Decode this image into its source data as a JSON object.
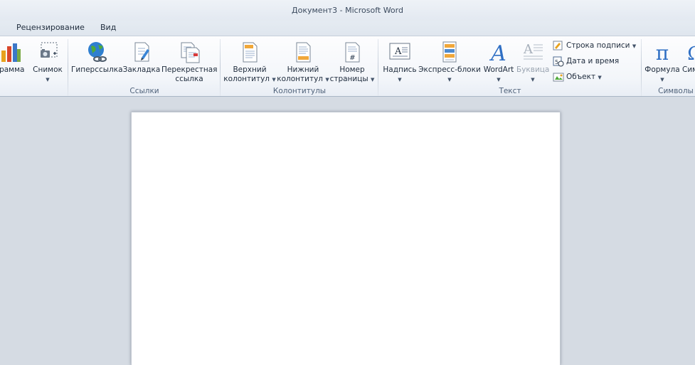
{
  "window": {
    "title": "Документ3 - Microsoft Word"
  },
  "tabs": [
    "Рецензирование",
    "Вид"
  ],
  "ribbon": {
    "illustrations": {
      "chart_label": "грамма",
      "screenshot_label": "Снимок"
    },
    "links": {
      "group_label": "Ссылки",
      "hyperlink": "Гиперссылка",
      "bookmark": "Закладка",
      "crossref_line1": "Перекрестная",
      "crossref_line2": "ссылка"
    },
    "header_footer": {
      "group_label": "Колонтитулы",
      "header_line1": "Верхний",
      "header_line2": "колонтитул",
      "footer_line1": "Нижний",
      "footer_line2": "колонтитул",
      "pagenum_line1": "Номер",
      "pagenum_line2": "страницы"
    },
    "text": {
      "group_label": "Текст",
      "textbox": "Надпись",
      "quickparts": "Экспресс-блоки",
      "wordart": "WordArt",
      "dropcap": "Буквица",
      "signature_line": "Строка подписи",
      "date_time": "Дата и время",
      "object": "Объект"
    },
    "symbols": {
      "group_label": "Символы",
      "equation": "Формула",
      "symbol": "Сим"
    }
  },
  "colors": {
    "accent": "#1f5fa8",
    "ribbon_bg": "#f3f6fa",
    "workspace": "#d5dbe3"
  }
}
